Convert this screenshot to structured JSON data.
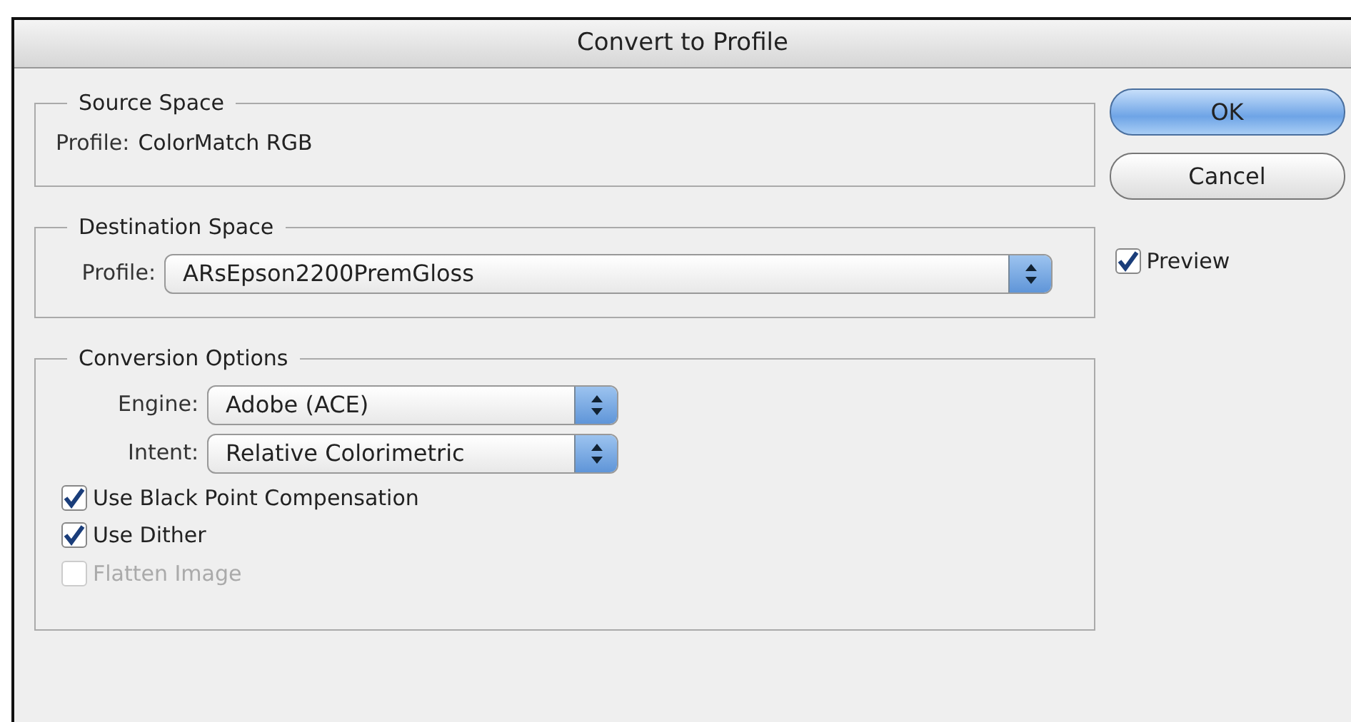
{
  "window": {
    "title": "Convert to Profile"
  },
  "source_space": {
    "legend": "Source Space",
    "profile_label": "Profile:",
    "profile_value": "ColorMatch RGB"
  },
  "destination_space": {
    "legend": "Destination Space",
    "fields": [
      {
        "label": "Profile:",
        "value": "ARsEpson2200PremGloss"
      }
    ]
  },
  "conversion_options": {
    "legend": "Conversion Options",
    "fields": [
      {
        "label": "Engine:",
        "value": "Adobe (ACE)"
      },
      {
        "label": "Intent:",
        "value": "Relative Colorimetric"
      }
    ],
    "checkboxes": [
      {
        "label": "Use Black Point Compensation",
        "checked": true,
        "disabled": false
      },
      {
        "label": "Use Dither",
        "checked": true,
        "disabled": false
      },
      {
        "label": "Flatten Image",
        "checked": false,
        "disabled": true
      }
    ]
  },
  "buttons": [
    {
      "label": "OK",
      "default": true
    },
    {
      "label": "Cancel",
      "default": false
    }
  ],
  "preview": {
    "label": "Preview",
    "checked": true,
    "disabled": false
  }
}
